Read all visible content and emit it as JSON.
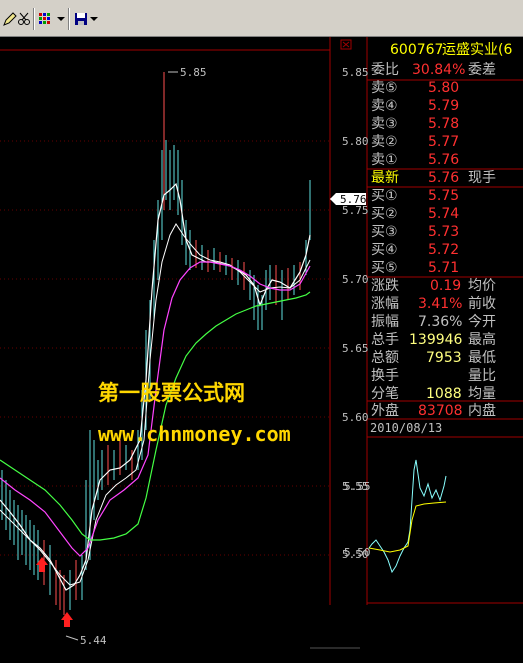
{
  "toolbar": {
    "icons": [
      "pencil-icon",
      "scissors-icon",
      "grid-menu-icon",
      "save-icon"
    ]
  },
  "chart": {
    "price_labels": [
      "5.85",
      "5.80",
      "5.75",
      "5.70",
      "5.65",
      "5.60",
      "5.55",
      "5.50"
    ],
    "current_price": "5.76",
    "high_label": "5.85",
    "low_label": "5.44",
    "watermark": {
      "line1": "第一股票公式网",
      "line2": "www.chnmoney.com"
    }
  },
  "quote": {
    "stock_code": "600767",
    "stock_name": "运盛实业(6",
    "weibi": {
      "label": "委比",
      "value": "30.84%",
      "right": "委差"
    },
    "sell": [
      {
        "label": "卖⑤",
        "price": "5.80"
      },
      {
        "label": "卖④",
        "price": "5.79"
      },
      {
        "label": "卖③",
        "price": "5.78"
      },
      {
        "label": "卖②",
        "price": "5.77"
      },
      {
        "label": "卖①",
        "price": "5.76"
      }
    ],
    "latest": {
      "label": "最新",
      "price": "5.76",
      "right": "现手"
    },
    "buy": [
      {
        "label": "买①",
        "price": "5.75"
      },
      {
        "label": "买②",
        "price": "5.74"
      },
      {
        "label": "买③",
        "price": "5.73"
      },
      {
        "label": "买④",
        "price": "5.72"
      },
      {
        "label": "买⑤",
        "price": "5.71"
      }
    ],
    "stats": [
      {
        "label": "涨跌",
        "value": "0.19",
        "right": "均价"
      },
      {
        "label": "涨幅",
        "value": "3.41%",
        "right": "前收"
      },
      {
        "label": "振幅",
        "value": "7.36%",
        "right": "今开"
      },
      {
        "label": "总手",
        "value": "139946",
        "right": "最高"
      },
      {
        "label": "总额",
        "value": "7953",
        "right": "最低"
      },
      {
        "label": "换手",
        "value": "",
        "right": "量比"
      },
      {
        "label": "分笔",
        "value": "1088",
        "right": "均量"
      },
      {
        "label": "外盘",
        "value": "83708",
        "right": "内盘"
      }
    ],
    "date": "2010/08/13",
    "mini_price_labels": [
      "5.55",
      "5.50"
    ]
  }
}
